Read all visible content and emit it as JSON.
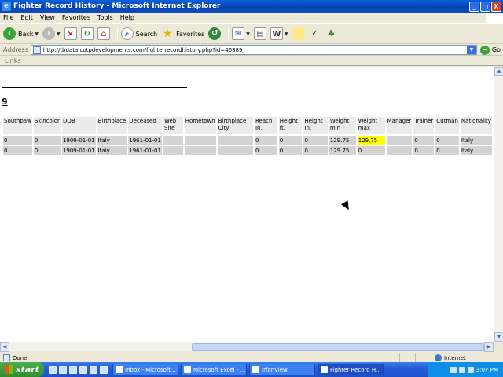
{
  "window": {
    "title": "Fighter Record History - Microsoft Internet Explorer",
    "min": "_",
    "max": "□",
    "close": "X"
  },
  "menu": [
    "File",
    "Edit",
    "View",
    "Favorites",
    "Tools",
    "Help"
  ],
  "toolbar": {
    "back_label": "Back",
    "search_label": "Search",
    "favorites_label": "Favorites"
  },
  "address": {
    "label": "Address",
    "url": "http://tbdata.cotpdevelopments.com/fighterrecordhistory.php?id=46389",
    "go_label": "Go"
  },
  "links_label": "Links",
  "page": {
    "heading": "9",
    "columns": [
      "Southpaw",
      "Skincolor",
      "DOB",
      "Birthplace",
      "Deceased",
      "Web Site",
      "Hometown",
      "Birthplace City",
      "Reach In.",
      "Height ft.",
      "Height In.",
      "Weight min",
      "Weight max",
      "Manager",
      "Trainer",
      "Cutman",
      "Nationality"
    ],
    "rows": [
      [
        "0",
        "0",
        "1909-01-01",
        "Italy",
        "1961-01-01",
        "",
        "",
        "",
        "0",
        "0",
        "0",
        "129.75",
        "129.75",
        "",
        "0",
        "0",
        "Italy"
      ],
      [
        "0",
        "0",
        "1909-01-01",
        "Italy",
        "1961-01-01",
        "",
        "",
        "",
        "0",
        "0",
        "0",
        "129.75",
        "0",
        "",
        "0",
        "0",
        "Italy"
      ]
    ]
  },
  "status": {
    "text": "Done",
    "zone": "Internet"
  },
  "taskbar": {
    "start_label": "start",
    "tasks": [
      "Inbox - Microsoft...",
      "Microsoft Excel - ...",
      "IrfanView",
      "Fighter Record H..."
    ],
    "clock": "3:07 PM"
  }
}
